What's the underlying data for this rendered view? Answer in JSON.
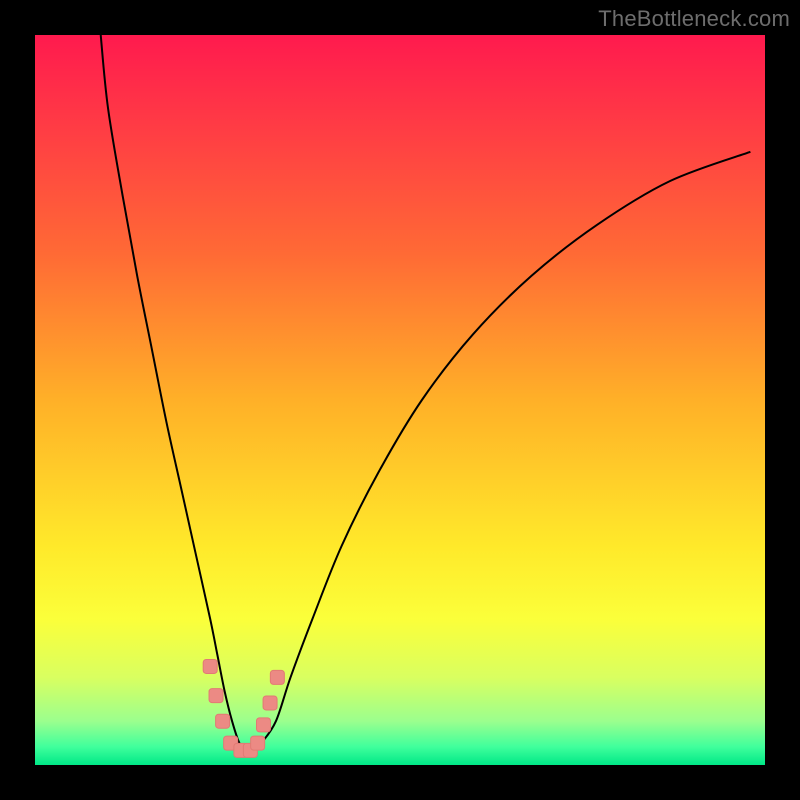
{
  "attribution": "TheBottleneck.com",
  "colors": {
    "frame": "#000000",
    "attribution_text": "#6d6d6d",
    "curve": "#000000",
    "marker_fill": "#ec8a84",
    "marker_stroke": "#e27a74",
    "gradient_stops": [
      {
        "offset": 0.0,
        "color": "#ff1a4e"
      },
      {
        "offset": 0.12,
        "color": "#ff3a45"
      },
      {
        "offset": 0.3,
        "color": "#ff6a35"
      },
      {
        "offset": 0.5,
        "color": "#ffb028"
      },
      {
        "offset": 0.7,
        "color": "#ffe92a"
      },
      {
        "offset": 0.8,
        "color": "#fbff3a"
      },
      {
        "offset": 0.88,
        "color": "#d9ff60"
      },
      {
        "offset": 0.94,
        "color": "#9bff8e"
      },
      {
        "offset": 0.975,
        "color": "#40ff9c"
      },
      {
        "offset": 1.0,
        "color": "#00e887"
      }
    ]
  },
  "chart_data": {
    "type": "line",
    "title": "",
    "xlabel": "",
    "ylabel": "",
    "xlim": [
      0,
      100
    ],
    "ylim": [
      0,
      100
    ],
    "series": [
      {
        "name": "bottleneck-curve",
        "x": [
          9,
          10,
          12,
          14,
          16,
          18,
          20,
          22,
          24,
          25,
          26,
          27,
          28,
          29,
          30,
          31,
          33,
          35,
          38,
          42,
          47,
          53,
          60,
          68,
          77,
          87,
          98
        ],
        "y": [
          100,
          90,
          78,
          67,
          57,
          47,
          38,
          29,
          20,
          15,
          10,
          6,
          3,
          2,
          2,
          3,
          6,
          12,
          20,
          30,
          40,
          50,
          59,
          67,
          74,
          80,
          84
        ]
      }
    ],
    "markers": {
      "name": "highlight-region",
      "x": [
        24.0,
        24.8,
        25.7,
        26.8,
        28.2,
        29.5,
        30.5,
        31.3,
        32.2,
        33.2
      ],
      "y": [
        13.5,
        9.5,
        6.0,
        3.0,
        2.0,
        2.0,
        3.0,
        5.5,
        8.5,
        12.0
      ]
    }
  }
}
